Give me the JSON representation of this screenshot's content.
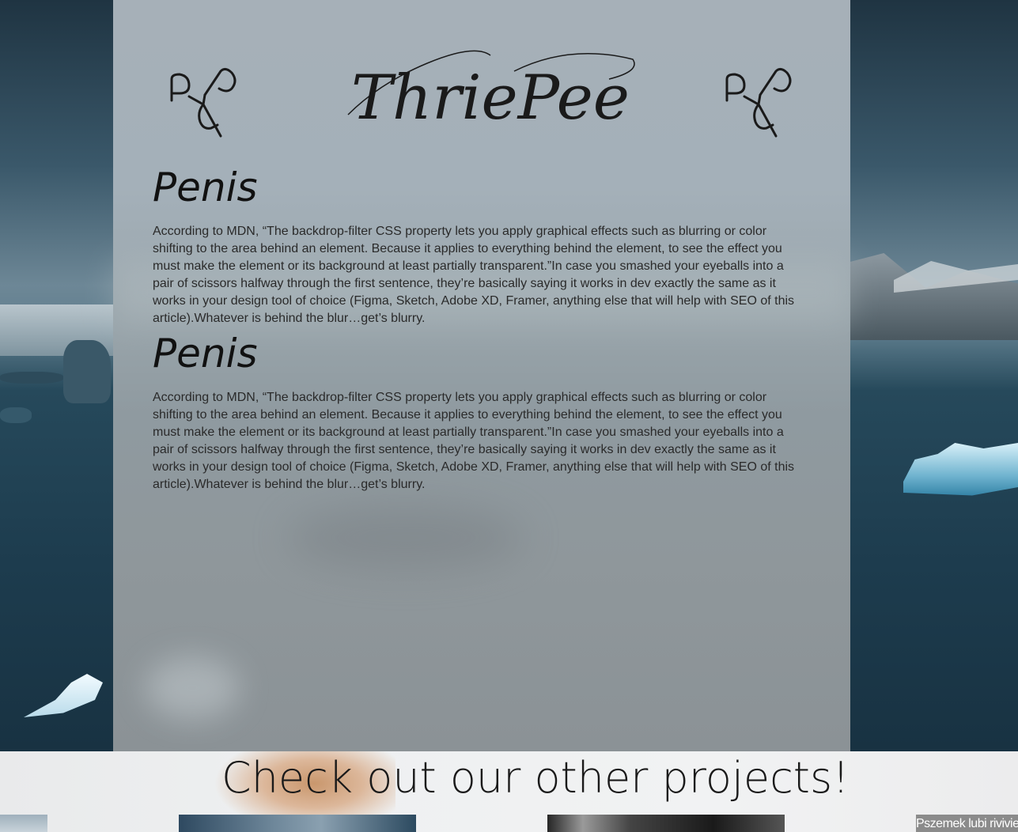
{
  "brand": {
    "logo_text": "ThriePee",
    "logo_mark_icon": "triple-p-monogram-icon"
  },
  "sections": [
    {
      "heading": "Penis",
      "body": "According to MDN, “The backdrop-filter CSS property lets you apply graphical effects such as blurring or color shifting to the area behind an element. Because it applies to everything behind the element, to see the effect you must make the element or its background at least partially transparent.”In case you smashed your eyeballs into a pair of scissors halfway through the first sentence, they’re basically saying it works in dev exactly the same as it works in your design tool of choice (Figma, Sketch, Adobe XD, Framer, anything else that will help with SEO of this article).Whatever is behind the blur…get’s blurry."
    },
    {
      "heading": "Penis",
      "body": "According to MDN, “The backdrop-filter CSS property lets you apply graphical effects such as blurring or color shifting to the area behind an element. Because it applies to everything behind the element, to see the effect you must make the element or its background at least partially transparent.”In case you smashed your eyeballs into a pair of scissors halfway through the first sentence, they’re basically saying it works in dev exactly the same as it works in your design tool of choice (Figma, Sketch, Adobe XD, Framer, anything else that will help with SEO of this article).Whatever is behind the blur…get’s blurry."
    }
  ],
  "footer": {
    "heading": "Check out our other projects!",
    "projects": [
      {
        "caption": ""
      },
      {
        "caption": ""
      },
      {
        "caption": ""
      },
      {
        "caption": "Pszemek lubi rivivie"
      }
    ]
  },
  "colors": {
    "panel": "#a0abb3",
    "text": "#111111",
    "footer_bg": "#eef0f1"
  }
}
